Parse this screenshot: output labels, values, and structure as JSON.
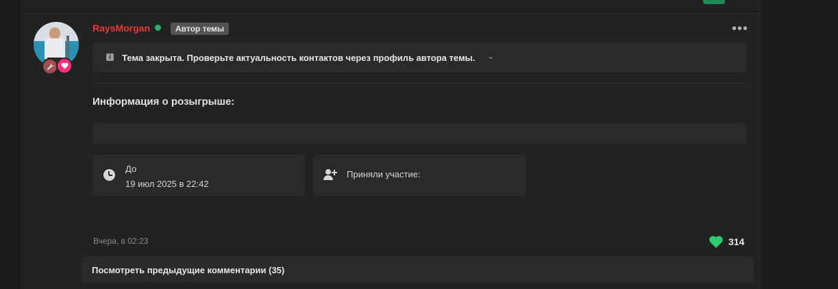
{
  "post": {
    "username": "RaysMorgan",
    "author_badge": "Автор темы",
    "more_icon": "more-dots-icon",
    "notice": {
      "icon": "info-icon",
      "text": "Тема закрыта. Проверьте актуальность контактов через профиль автора темы.",
      "chevron": "⌄"
    },
    "giveaway": {
      "title": "Информация о розыгрыше:",
      "until_label": "До",
      "until_value": "19 июл 2025 в 22:42",
      "participants_label": "Приняли участие:"
    },
    "timestamp": "Вчера, в 02:23",
    "likes": "314"
  },
  "comments": {
    "view_previous": "Посмотреть предыдущие комментарии (35)"
  },
  "colors": {
    "username": "#e53935",
    "online": "#2eae6d",
    "like_heart": "#2ecc71",
    "badge_heart": "#ff2d7e"
  }
}
